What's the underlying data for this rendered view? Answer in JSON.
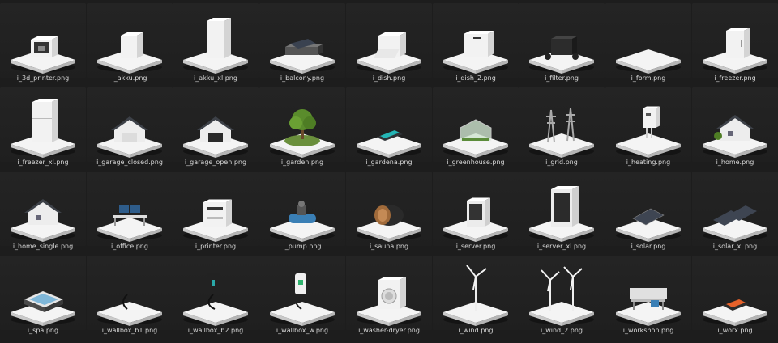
{
  "files": [
    {
      "name": "i_3d_printer.png",
      "icon": "3d-printer-icon"
    },
    {
      "name": "i_akku.png",
      "icon": "battery-icon"
    },
    {
      "name": "i_akku_xl.png",
      "icon": "battery-xl-icon"
    },
    {
      "name": "i_balcony.png",
      "icon": "balcony-solar-icon"
    },
    {
      "name": "i_dish.png",
      "icon": "dishwasher-icon"
    },
    {
      "name": "i_dish_2.png",
      "icon": "dishwasher-2-icon"
    },
    {
      "name": "i_filter.png",
      "icon": "filter-icon"
    },
    {
      "name": "i_form.png",
      "icon": "form-icon"
    },
    {
      "name": "i_freezer.png",
      "icon": "freezer-icon"
    },
    {
      "name": "i_freezer_xl.png",
      "icon": "freezer-xl-icon"
    },
    {
      "name": "i_garage_closed.png",
      "icon": "garage-closed-icon"
    },
    {
      "name": "i_garage_open.png",
      "icon": "garage-open-icon"
    },
    {
      "name": "i_garden.png",
      "icon": "garden-icon"
    },
    {
      "name": "i_gardena.png",
      "icon": "mower-icon"
    },
    {
      "name": "i_greenhouse.png",
      "icon": "greenhouse-icon"
    },
    {
      "name": "i_grid.png",
      "icon": "power-grid-icon"
    },
    {
      "name": "i_heating.png",
      "icon": "heating-icon"
    },
    {
      "name": "i_home.png",
      "icon": "home-icon"
    },
    {
      "name": "i_home_single.png",
      "icon": "home-single-icon"
    },
    {
      "name": "i_office.png",
      "icon": "office-icon"
    },
    {
      "name": "i_printer.png",
      "icon": "printer-icon"
    },
    {
      "name": "i_pump.png",
      "icon": "pump-icon"
    },
    {
      "name": "i_sauna.png",
      "icon": "sauna-icon"
    },
    {
      "name": "i_server.png",
      "icon": "server-icon"
    },
    {
      "name": "i_server_xl.png",
      "icon": "server-xl-icon"
    },
    {
      "name": "i_solar.png",
      "icon": "solar-icon"
    },
    {
      "name": "i_solar_xl.png",
      "icon": "solar-xl-icon"
    },
    {
      "name": "i_spa.png",
      "icon": "spa-icon"
    },
    {
      "name": "i_wallbox_b1.png",
      "icon": "wallbox-b1-icon"
    },
    {
      "name": "i_wallbox_b2.png",
      "icon": "wallbox-b2-icon"
    },
    {
      "name": "i_wallbox_w.png",
      "icon": "wallbox-w-icon"
    },
    {
      "name": "i_washer-dryer.png",
      "icon": "washer-dryer-icon"
    },
    {
      "name": "i_wind.png",
      "icon": "wind-turbine-icon"
    },
    {
      "name": "i_wind_2.png",
      "icon": "wind-turbines-icon"
    },
    {
      "name": "i_workshop.png",
      "icon": "workshop-icon"
    },
    {
      "name": "i_worx.png",
      "icon": "robot-mower-icon"
    }
  ]
}
